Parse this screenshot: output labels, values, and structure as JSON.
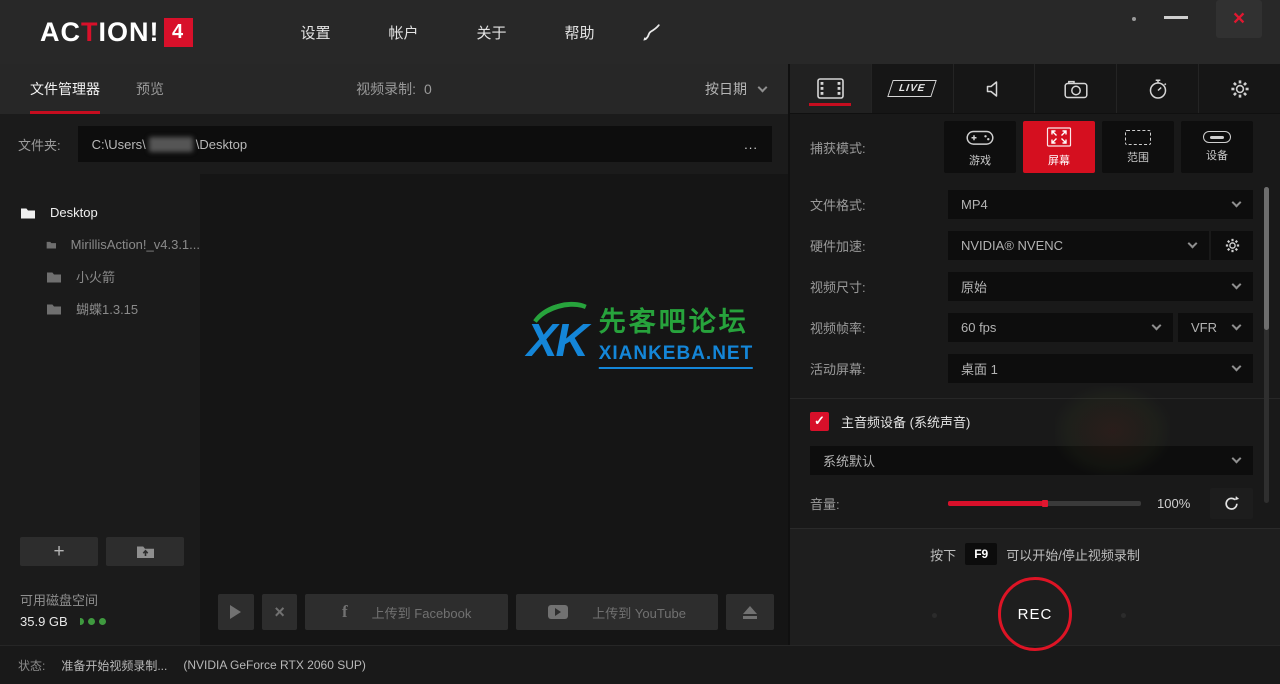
{
  "topbar": {
    "logo": {
      "part1": "AC",
      "part2": "T",
      "part3": "ION!",
      "badge": "4"
    },
    "menu": [
      {
        "label": "设置"
      },
      {
        "label": "帐户"
      },
      {
        "label": "关于"
      },
      {
        "label": "帮助"
      }
    ]
  },
  "left_panel": {
    "tab_file_manager": "文件管理器",
    "tab_preview": "预览",
    "recordings_label": "视频录制:",
    "recordings_count": "0",
    "sort_label": "按日期",
    "folder_label": "文件夹:",
    "folder_path_prefix": "C:\\Users\\",
    "folder_path_suffix": "\\Desktop",
    "browse_label": "...",
    "tree_root": "Desktop",
    "tree_children": [
      {
        "label": "MirillisAction!_v4.3.1..."
      },
      {
        "label": "小火箭"
      },
      {
        "label": "蝴蝶1.3.15"
      }
    ],
    "disk_space_label": "可用磁盘空间",
    "disk_space_value": "35.9 GB",
    "upload_facebook_label": "上传到 Facebook",
    "upload_youtube_label": "上传到 YouTube"
  },
  "right_panel": {
    "live_tab_label": "LIVE",
    "capture_mode_label": "捕获模式:",
    "modes": [
      {
        "label": "游戏"
      },
      {
        "label": "屏幕"
      },
      {
        "label": "范围"
      },
      {
        "label": "设备"
      }
    ],
    "rows": [
      {
        "label": "文件格式:",
        "value": "MP4"
      },
      {
        "label": "硬件加速:",
        "value": "NVIDIA® NVENC"
      },
      {
        "label": "视频尺寸:",
        "value": "原始"
      },
      {
        "label": "视频帧率:",
        "value": "60 fps",
        "extra": "VFR"
      },
      {
        "label": "活动屏幕:",
        "value": "桌面 1"
      }
    ],
    "audio_checkbox_label": "主音频设备 (系统声音)",
    "audio_device_value": "系统默认",
    "volume_label": "音量:",
    "volume_value": "100%",
    "volume_fill_ratio": 0.5,
    "hotkey_prefix": "按下",
    "hotkey_key": "F9",
    "hotkey_suffix": "可以开始/停止视频录制",
    "rec_button_label": "REC"
  },
  "watermark": {
    "logo_text": "XK",
    "line1": "先客吧论坛",
    "line2": "XIANKEBA.NET"
  },
  "statusbar": {
    "label": "状态:",
    "message": "准备开始视频录制...",
    "device": "(NVIDIA GeForce RTX 2060 SUP)"
  },
  "glyphs": {
    "plus": "+",
    "check": "✓",
    "close": "×",
    "multiply": "×",
    "facebook_f": "f"
  },
  "colors": {
    "accent_red": "#d8102a",
    "selected_mode_red": "#d50f1f",
    "watermark_green": "#27a33c",
    "watermark_blue": "#1486d8",
    "disk_green": "#3f9a3f"
  }
}
